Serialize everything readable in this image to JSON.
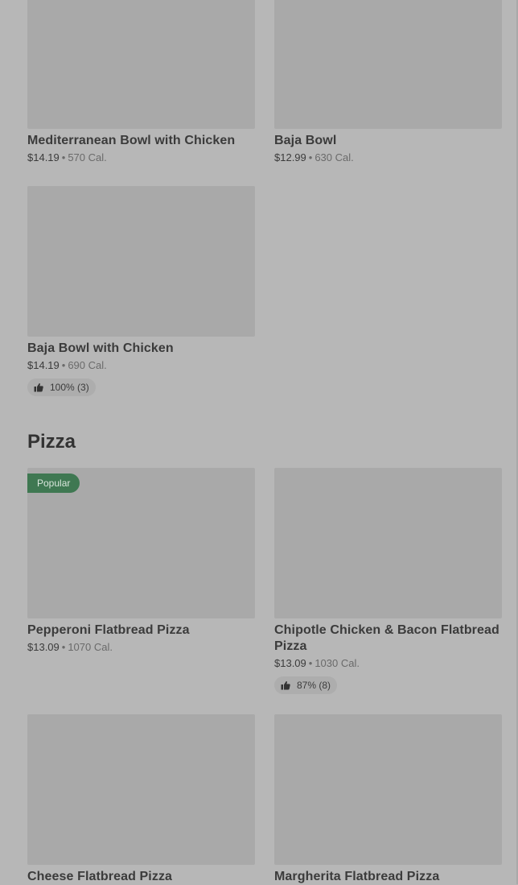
{
  "sections": {
    "bowls": {
      "items": [
        {
          "name": "Mediterranean Bowl with Chicken",
          "price": "$14.19",
          "calories": "570 Cal."
        },
        {
          "name": "Baja Bowl",
          "price": "$12.99",
          "calories": "630 Cal."
        },
        {
          "name": "Baja Bowl with Chicken",
          "price": "$14.19",
          "calories": "690 Cal.",
          "rating": "100% (3)"
        }
      ]
    },
    "pizza": {
      "title": "Pizza",
      "items": [
        {
          "name": "Pepperoni Flatbread Pizza",
          "price": "$13.09",
          "calories": "1070 Cal.",
          "badge": "Popular"
        },
        {
          "name": "Chipotle Chicken & Bacon Flatbread Pizza",
          "price": "$13.09",
          "calories": "1030 Cal.",
          "rating": "87% (8)"
        },
        {
          "name": "Cheese Flatbread Pizza"
        },
        {
          "name": "Margherita Flatbread Pizza"
        }
      ]
    }
  },
  "separator": "•",
  "icons": {
    "rating": "thumbs-up-icon"
  },
  "colors": {
    "background": "#b7b7b7",
    "image_placeholder": "#a9a9a9",
    "badge_background": "#3f7852",
    "text_primary": "#3b3b3b",
    "text_secondary": "#6a6a6a"
  }
}
